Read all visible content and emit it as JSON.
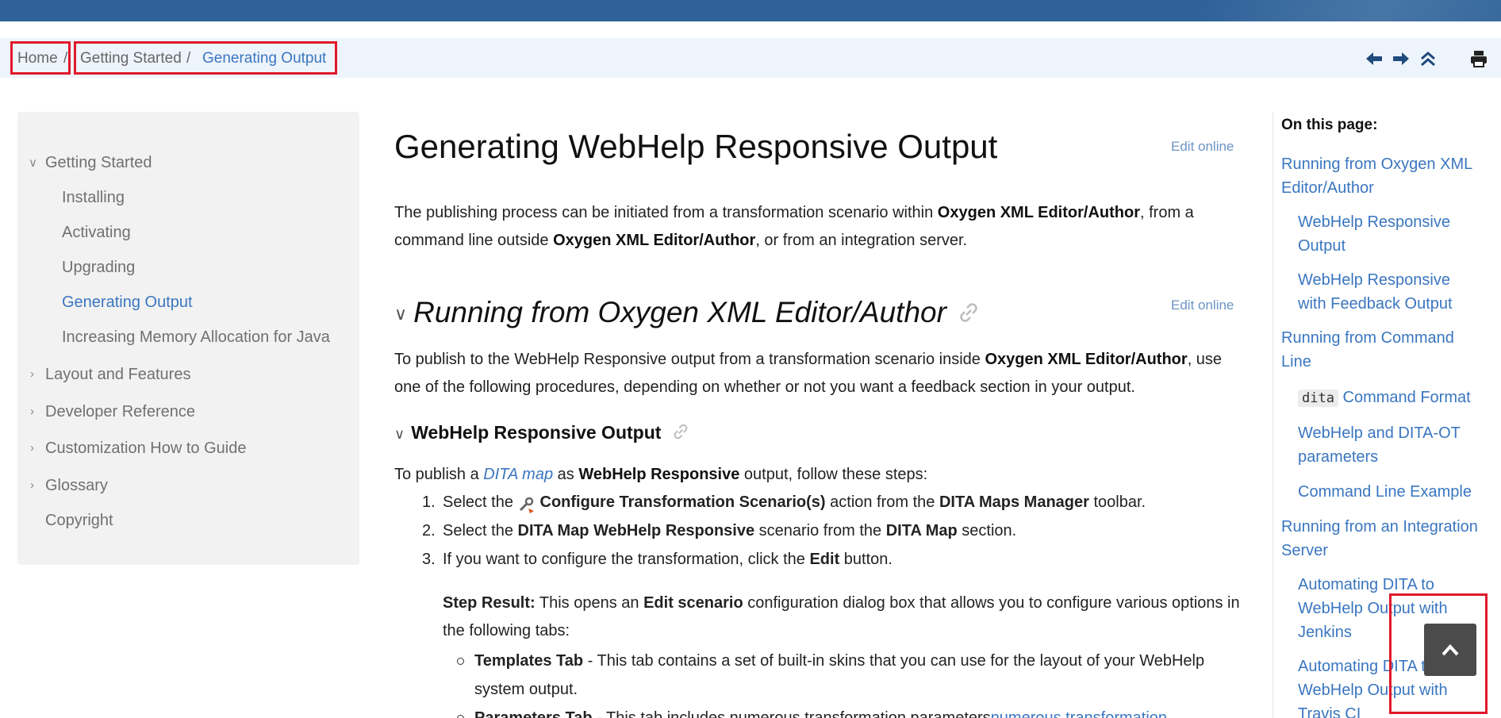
{
  "breadcrumb": {
    "home": "Home",
    "separator": "/",
    "getting_started": "Getting Started",
    "current": "Generating Output"
  },
  "toolbar_icons": [
    "arrow-left-icon",
    "arrow-right-icon",
    "double-chevron-up-icon",
    "printer-icon"
  ],
  "toc": {
    "items": [
      {
        "label": "Getting Started",
        "expanded": true
      },
      {
        "label": "Installing"
      },
      {
        "label": "Activating"
      },
      {
        "label": "Upgrading"
      },
      {
        "label": "Generating Output",
        "active": true
      },
      {
        "label": "Increasing Memory Allocation for Java"
      },
      {
        "label": "Layout and Features",
        "expanded": false
      },
      {
        "label": "Developer Reference",
        "expanded": false
      },
      {
        "label": "Customization How to Guide",
        "expanded": false
      },
      {
        "label": "Glossary",
        "expanded": false
      },
      {
        "label": "Copyright"
      }
    ]
  },
  "main": {
    "title": "Generating WebHelp Responsive Output",
    "edit_online": "Edit online",
    "intro": {
      "t1": "The publishing process can be initiated from a transformation scenario within ",
      "b1": "Oxygen XML Editor/Author",
      "t2": ", from a command line outside ",
      "b2": "Oxygen XML Editor/Author",
      "t3": ", or from an integration server."
    },
    "section1": {
      "title": "Running from Oxygen XML Editor/Author",
      "p_t1": "To publish to the WebHelp Responsive output from a transformation scenario inside ",
      "p_b1": "Oxygen XML Editor/Author",
      "p_t2": ", use one of the following procedures, depending on whether or not you want a feedback section in your output."
    },
    "subsection": {
      "title": "WebHelp Responsive Output",
      "lead_t1": "To publish a ",
      "lead_link": "DITA map",
      "lead_t2": " as ",
      "lead_b1": "WebHelp Responsive",
      "lead_t3": " output, follow these steps:"
    },
    "steps": [
      {
        "num": "1.",
        "t1": "Select the ",
        "b1": "Configure Transformation Scenario(s)",
        "t2": " action from the ",
        "b2": "DITA Maps Manager",
        "t3": " toolbar."
      },
      {
        "num": "2.",
        "t1": "Select the ",
        "b1": "DITA Map WebHelp Responsive",
        "t2": " scenario from the ",
        "b2": "DITA Map",
        "t3": " section."
      },
      {
        "num": "3.",
        "t1": "If you want to configure the transformation, click the ",
        "b1": "Edit",
        "t2": " button."
      }
    ],
    "step_result": {
      "label": "Step Result:",
      "t1": " This opens an ",
      "b1": "Edit scenario",
      "t2": " configuration dialog box that allows you to configure various options in the following tabs:"
    },
    "tabs_list": [
      {
        "b": "Templates Tab",
        "t": " - This tab contains a set of built-in skins that you can use for the layout of your WebHelp system output."
      },
      {
        "b": "Parameters Tab",
        "t": " - This tab includes numerous transformation parameters",
        "link": "numerous transformation"
      }
    ]
  },
  "on_this_page": {
    "title": "On this page:",
    "links": [
      {
        "text": "Running from Oxygen XML Editor/Author",
        "level": 1
      },
      {
        "text": "WebHelp Responsive Output",
        "level": 2
      },
      {
        "text": "WebHelp Responsive with Feedback Output",
        "level": 2
      },
      {
        "text": "Running from Command Line",
        "level": 1
      },
      {
        "code": "dita",
        "text": " Command Format",
        "level": 2
      },
      {
        "text": "WebHelp and DITA-OT parameters",
        "level": 2
      },
      {
        "text": "Command Line Example",
        "level": 2
      },
      {
        "text": "Running from an Integration Server",
        "level": 1
      },
      {
        "text": "Automating DITA to WebHelp Output with Jenkins",
        "level": 2
      },
      {
        "text": "Automating DITA to WebHelp Output with Travis CI",
        "level": 2
      }
    ]
  },
  "colors": {
    "topbar": "#2e6299",
    "crumbbar": "#eef4fb",
    "link": "#3a76c0",
    "highlight": "#e0192a"
  }
}
